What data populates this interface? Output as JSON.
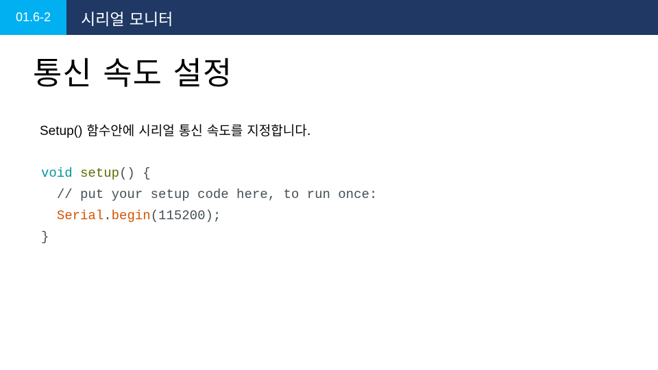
{
  "header": {
    "badge": "01.6-2",
    "section_title": "시리얼 모니터"
  },
  "slide": {
    "title": "통신 속도 설정",
    "description_code_word": "Setup()",
    "description_rest": " 함수안에 시리얼 통신 속도를 지정합니다."
  },
  "code": {
    "line1_type": "void",
    "line1_func": "setup",
    "line1_rest": "() {",
    "line2_comment": "// put your setup code here, to run once:",
    "line3_obj": "Serial",
    "line3_dot": ".",
    "line3_method": "begin",
    "line3_rest": "(115200);",
    "line4": "}"
  },
  "colors": {
    "header_bg": "#1f3864",
    "badge_bg": "#00b0f0",
    "code_type": "#00979c",
    "code_func": "#5e6d03",
    "code_object": "#d35400"
  }
}
